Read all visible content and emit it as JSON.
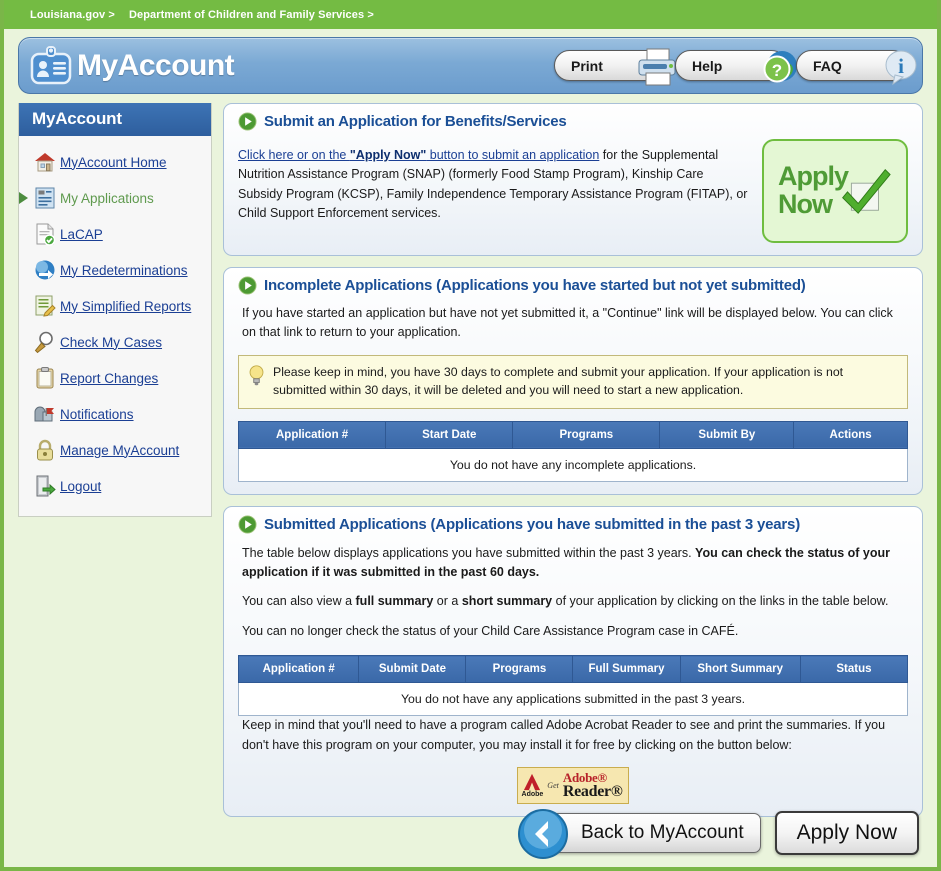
{
  "breadcrumb": {
    "items": [
      "Louisiana.gov >",
      "Department of Children and Family Services >"
    ]
  },
  "header": {
    "logo_icon": "id-badge-icon",
    "title": "MyAccount",
    "buttons": [
      {
        "label": "Print",
        "icon": "printer-icon"
      },
      {
        "label": "Help",
        "icon": "globe-question-icon"
      },
      {
        "label": "FAQ",
        "icon": "info-bubble-icon"
      }
    ]
  },
  "sidebar": {
    "title": "MyAccount",
    "items": [
      {
        "label": "MyAccount Home",
        "icon": "house-icon",
        "active": false
      },
      {
        "label": "My Applications",
        "icon": "document-list-icon",
        "active": true
      },
      {
        "label": "LaCAP",
        "icon": "document-check-icon",
        "active": false
      },
      {
        "label": "My Redeterminations",
        "icon": "blue-refresh-icon",
        "active": false
      },
      {
        "label": "My Simplified Reports",
        "icon": "report-pencil-icon",
        "active": false
      },
      {
        "label": "Check My Cases",
        "icon": "magnifier-icon",
        "active": false
      },
      {
        "label": "Report Changes",
        "icon": "clipboard-icon",
        "active": false
      },
      {
        "label": "Notifications",
        "icon": "mailbox-icon",
        "active": false
      },
      {
        "label": "Manage MyAccount",
        "icon": "padlock-icon",
        "active": false
      },
      {
        "label": "Logout",
        "icon": "exit-door-icon",
        "active": false
      }
    ]
  },
  "panel_submit": {
    "icon": "green-play-icon",
    "title": "Submit an Application for Benefits/Services",
    "link_part1": "Click here or on the ",
    "link_bold": "\"Apply Now\"",
    "link_part2": " button to submit an application",
    "rest": " for the Supplemental Nutrition Assistance Program (SNAP) (formerly Food Stamp Program), Kinship Care Subsidy Program (KCSP), Family Independence Temporary Assistance Program (FITAP), or Child Support Enforcement services.",
    "apply_box": {
      "line1": "Apply",
      "line2": "Now",
      "icon": "green-checkmark-icon"
    }
  },
  "panel_incomplete": {
    "icon": "green-play-icon",
    "title": "Incomplete Applications (Applications you have started but not yet submitted)",
    "intro": "If you have started an application but have not yet submitted it, a \"Continue\" link will be displayed below. You can click on that link to return to your application.",
    "tip_icon": "lightbulb-icon",
    "tip": "Please keep in mind, you have 30 days to complete and submit your application. If your application is not submitted within 30 days, it will be deleted and you will need to start a new application.",
    "table": {
      "columns": [
        "Application #",
        "Start Date",
        "Programs",
        "Submit By",
        "Actions"
      ],
      "empty_message": "You do not have any incomplete applications.",
      "rows": []
    }
  },
  "panel_submitted": {
    "icon": "green-play-icon",
    "title": "Submitted Applications (Applications you have submitted in the past 3 years)",
    "para1_a": "The table below displays applications you have submitted within the past 3 years. ",
    "para1_b": "You can check the status of your application if it was submitted in the past 60 days.",
    "para2_a": "You can also view a ",
    "para2_b": "full summary",
    "para2_c": " or a ",
    "para2_d": "short summary",
    "para2_e": " of your application by clicking on the links in the table below.",
    "para3": "You can no longer check the status of your Child Care Assistance Program case in CAFÉ.",
    "table": {
      "columns": [
        "Application #",
        "Submit Date",
        "Programs",
        "Full Summary",
        "Short Summary",
        "Status"
      ],
      "empty_message": "You do not have any applications submitted in the past 3 years.",
      "rows": []
    },
    "footnote": "Keep in mind that you'll need to have a program called Adobe Acrobat Reader to see and print the summaries. If you don't have this program on your computer, you may install it for free by clicking on the button below:",
    "adobe_button": {
      "icon": "adobe-a-icon",
      "brand": "Adobe",
      "get": "Get",
      "word1": "Adobe®",
      "word2": "Reader®"
    }
  },
  "footer": {
    "back_label": "Back to MyAccount",
    "back_icon": "blue-back-arrow-icon",
    "apply_label": "Apply Now"
  },
  "colors": {
    "brand_green": "#74bb43",
    "page_bg": "#eaf4dc",
    "header_blue": "#7ba9d4",
    "sidebar_head": "#2e5e9e",
    "table_head": "#3a68a8",
    "link_blue": "#1b3f94",
    "panel_title": "#1b4f96",
    "tip_bg": "#fcfbe0",
    "apply_green": "#6fbd3f"
  }
}
